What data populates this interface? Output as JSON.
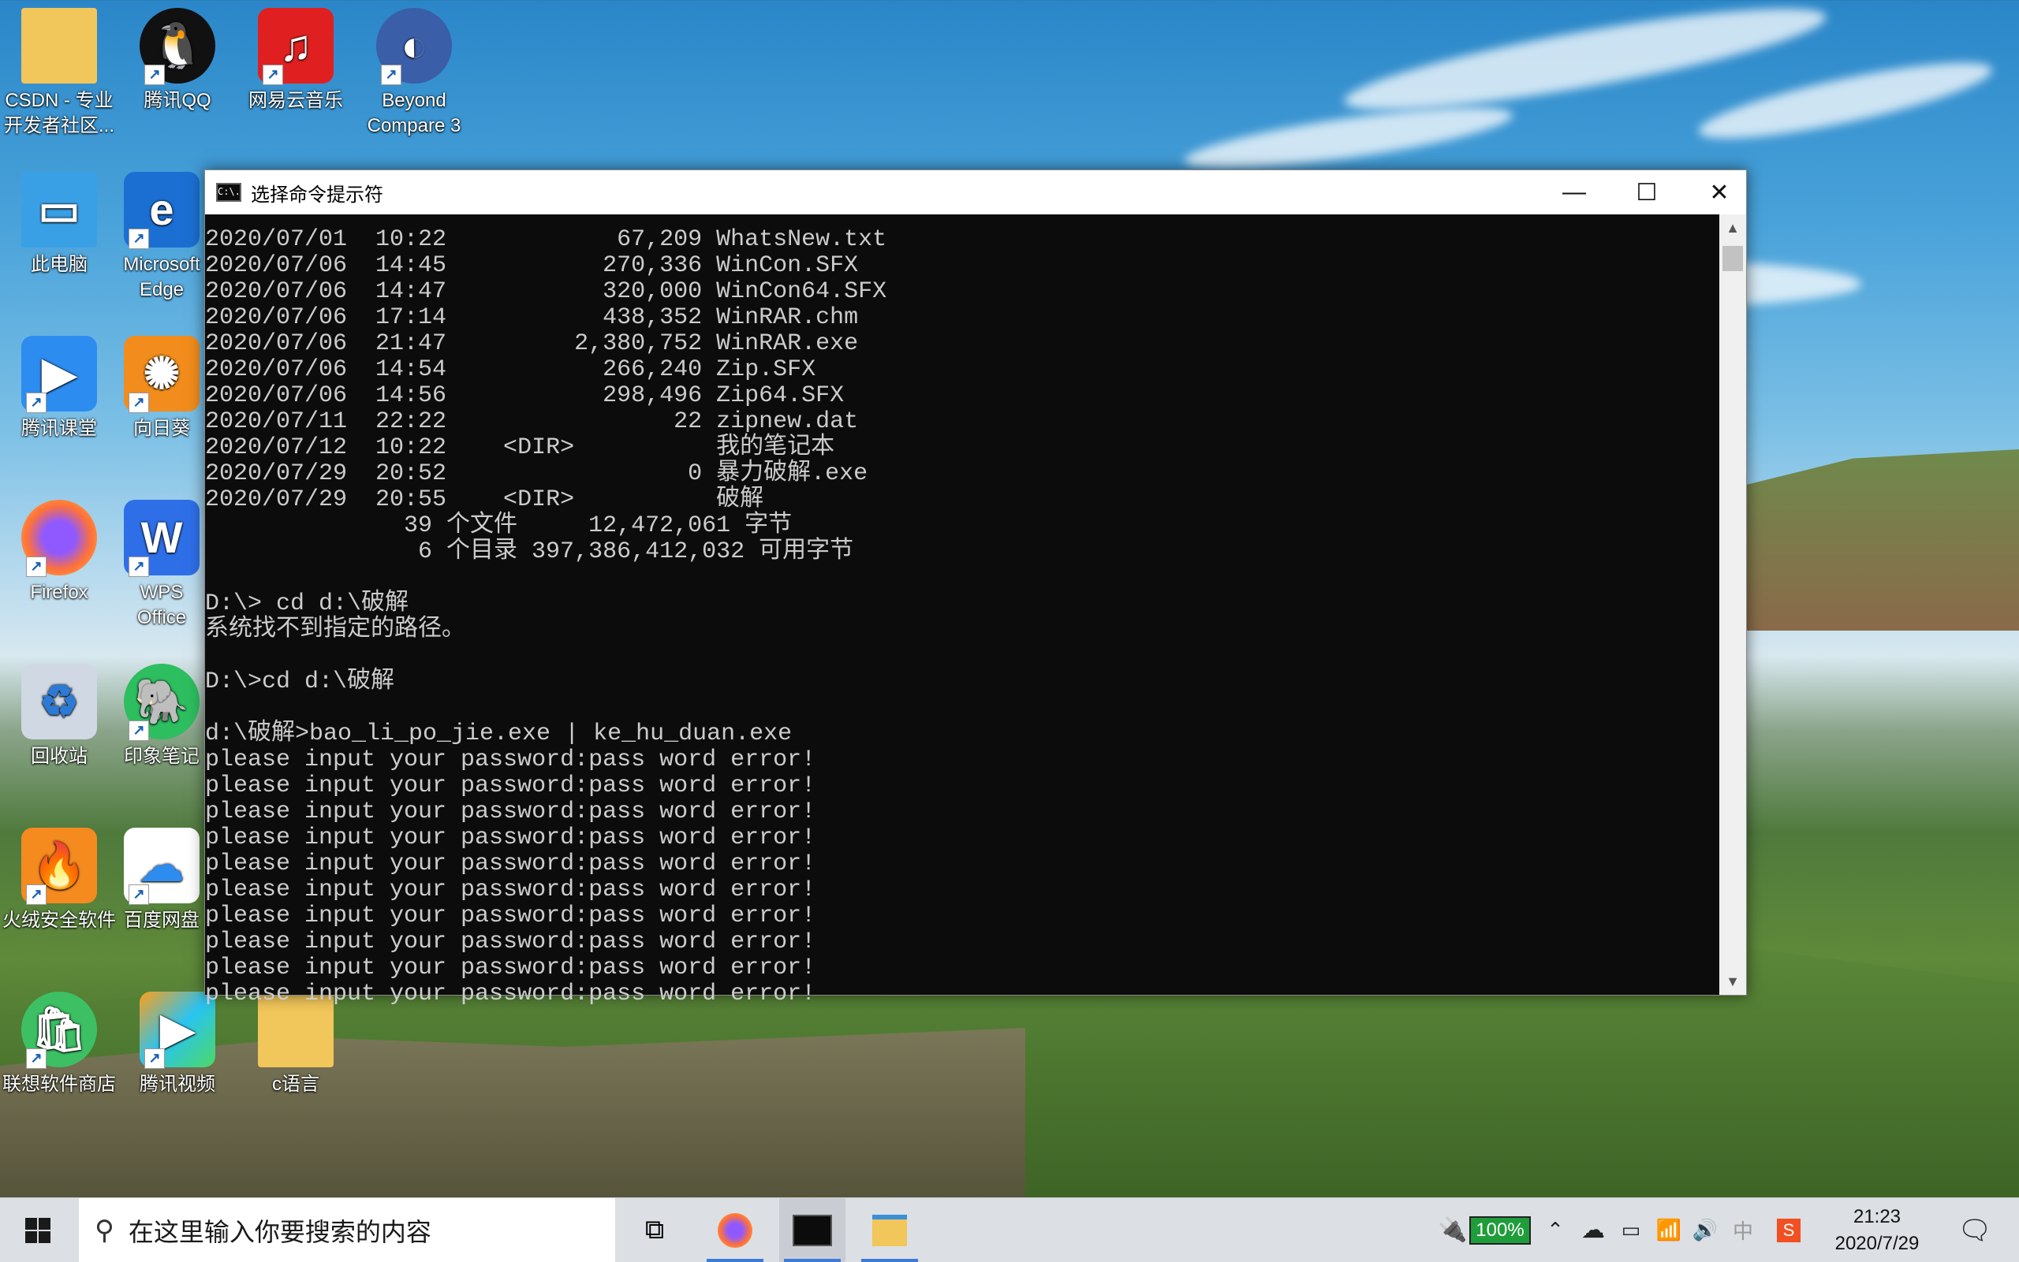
{
  "desktop": {
    "icons": [
      {
        "label": "CSDN - 专业开发者社区...",
        "icon": "folder-icon",
        "color": "#f1c65a"
      },
      {
        "label": "腾讯QQ",
        "icon": "penguin-icon",
        "color": "#111111"
      },
      {
        "label": "网易云音乐",
        "icon": "music-icon",
        "color": "#e02020"
      },
      {
        "label": "Beyond Compare 3",
        "icon": "compare-icon",
        "color": "#3a5ea8"
      },
      {
        "label": "此电脑",
        "icon": "computer-icon",
        "color": "#3aa0e6"
      },
      {
        "label": "Microsoft Edge",
        "icon": "edge-icon",
        "color": "#1b6fd2"
      },
      {
        "label": "腾讯课堂",
        "icon": "play-icon",
        "color": "#2d8cf0"
      },
      {
        "label": "向日葵",
        "icon": "sunflower-icon",
        "color": "#f28c1c"
      },
      {
        "label": "Firefox",
        "icon": "firefox-icon",
        "color": "#ff7139"
      },
      {
        "label": "WPS Office",
        "icon": "wps-icon",
        "color": "#2e6fe8"
      },
      {
        "label": "回收站",
        "icon": "recycle-bin-icon",
        "color": "#cfd8e3"
      },
      {
        "label": "印象笔记",
        "icon": "elephant-icon",
        "color": "#2dbe60"
      },
      {
        "label": "火绒安全软件",
        "icon": "flame-icon",
        "color": "#f58a1f"
      },
      {
        "label": "百度网盘",
        "icon": "cloud-drive-icon",
        "color": "#2d8cf0"
      },
      {
        "label": "联想软件商店",
        "icon": "store-bag-icon",
        "color": "#3cc063"
      },
      {
        "label": "腾讯视频",
        "icon": "video-play-icon",
        "color": "#ff9f1a"
      },
      {
        "label": "c语言",
        "icon": "folder-icon",
        "color": "#f1c65a"
      }
    ]
  },
  "cmd": {
    "title": "选择命令提示符",
    "icon_label": "C:\\.",
    "lines": [
      "2020/07/01  10:22            67,209 WhatsNew.txt",
      "2020/07/06  14:45           270,336 WinCon.SFX",
      "2020/07/06  14:47           320,000 WinCon64.SFX",
      "2020/07/06  17:14           438,352 WinRAR.chm",
      "2020/07/06  21:47         2,380,752 WinRAR.exe",
      "2020/07/06  14:54           266,240 Zip.SFX",
      "2020/07/06  14:56           298,496 Zip64.SFX",
      "2020/07/11  22:22                22 zipnew.dat",
      "2020/07/12  10:22    <DIR>          我的笔记本",
      "2020/07/29  20:52                 0 暴力破解.exe",
      "2020/07/29  20:55    <DIR>          破解",
      "              39 个文件     12,472,061 字节",
      "               6 个目录 397,386,412,032 可用字节",
      "",
      "D:\\> cd d:\\破解",
      "系统找不到指定的路径。",
      "",
      "D:\\>cd d:\\破解",
      "",
      "d:\\破解>bao_li_po_jie.exe | ke_hu_duan.exe",
      "please input your password:pass word error!",
      "please input your password:pass word error!",
      "please input your password:pass word error!",
      "please input your password:pass word error!",
      "please input your password:pass word error!",
      "please input your password:pass word error!",
      "please input your password:pass word error!",
      "please input your password:pass word error!",
      "please input your password:pass word error!",
      "please input your password:pass word error!"
    ],
    "minimize_glyph": "—",
    "maximize_glyph": "☐",
    "close_glyph": "✕"
  },
  "taskbar": {
    "start_icon": "windows-start-icon",
    "search_placeholder": "在这里输入你要搜索的内容",
    "search_icon": "search-icon",
    "task_view_icon": "task-view-icon",
    "apps": [
      {
        "name": "firefox-taskbar",
        "icon": "firefox-icon"
      },
      {
        "name": "cmd-taskbar",
        "icon": "terminal-icon"
      },
      {
        "name": "explorer-taskbar",
        "icon": "folder-icon"
      }
    ],
    "battery": "100%",
    "ime": "中",
    "clock_time": "21:23",
    "clock_date": "2020/7/29",
    "accent": "#3b7bd6"
  }
}
